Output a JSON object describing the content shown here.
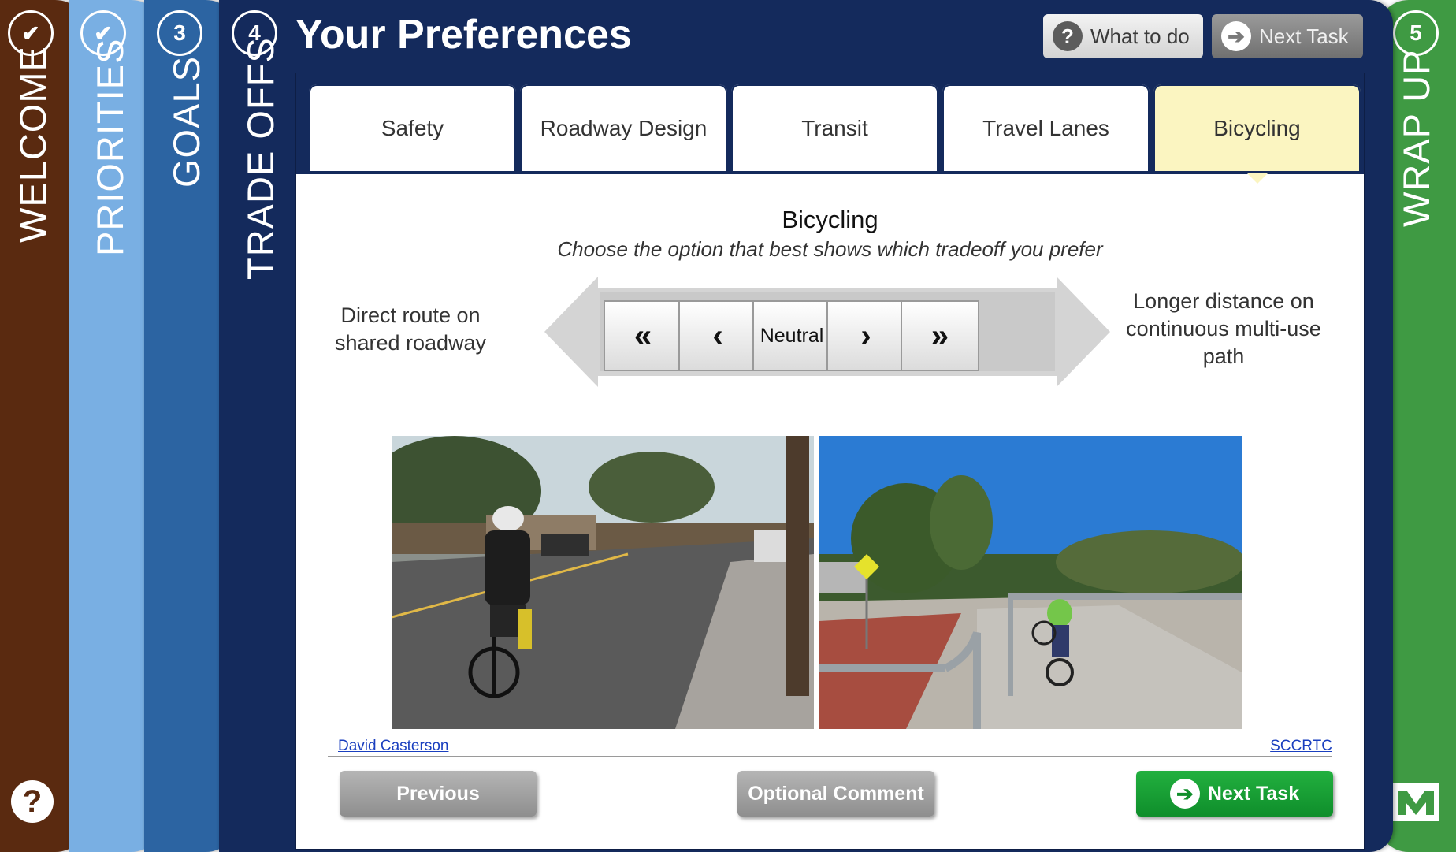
{
  "steps": {
    "welcome": {
      "label": "WELCOME",
      "badge": "✔"
    },
    "priorities": {
      "label": "PRIORITIES",
      "badge": "✔"
    },
    "goals": {
      "label": "GOALS",
      "badge": "3"
    },
    "tradeoffs": {
      "label": "TRADE OFFS",
      "badge": "4"
    },
    "wrapup": {
      "label": "WRAP UP",
      "badge": "5"
    }
  },
  "header": {
    "title": "Your Preferences",
    "what_to_do": "What to do",
    "next_task": "Next Task"
  },
  "tabs": [
    "Safety",
    "Roadway Design",
    "Transit",
    "Travel Lanes",
    "Bicycling"
  ],
  "active_tab": "Bicycling",
  "question": {
    "title": "Bicycling",
    "subtitle": "Choose the option that best shows which tradeoff you prefer",
    "left_option": "Direct route on shared roadway",
    "right_option": "Longer distance on continuous multi-use path"
  },
  "slider": {
    "buttons": [
      "«",
      "‹",
      "Neutral",
      "›",
      "»"
    ]
  },
  "credits": {
    "left": "David Casterson",
    "right": "SCCRTC"
  },
  "footer": {
    "previous": "Previous",
    "optional_comment": "Optional Comment",
    "next_task": "Next Task"
  },
  "colors": {
    "welcome": "#5a2a10",
    "priorities": "#79afe3",
    "goals": "#2c64a2",
    "tradeoffs": "#142a5c",
    "wrapup": "#3f9a43",
    "active_tab": "#fbf5c1",
    "next_green": "#1aa336"
  },
  "icons": {
    "help": "question-circle-icon",
    "next": "arrow-right-circle-icon",
    "check": "check-icon",
    "logo": "mtc-logo-icon"
  }
}
